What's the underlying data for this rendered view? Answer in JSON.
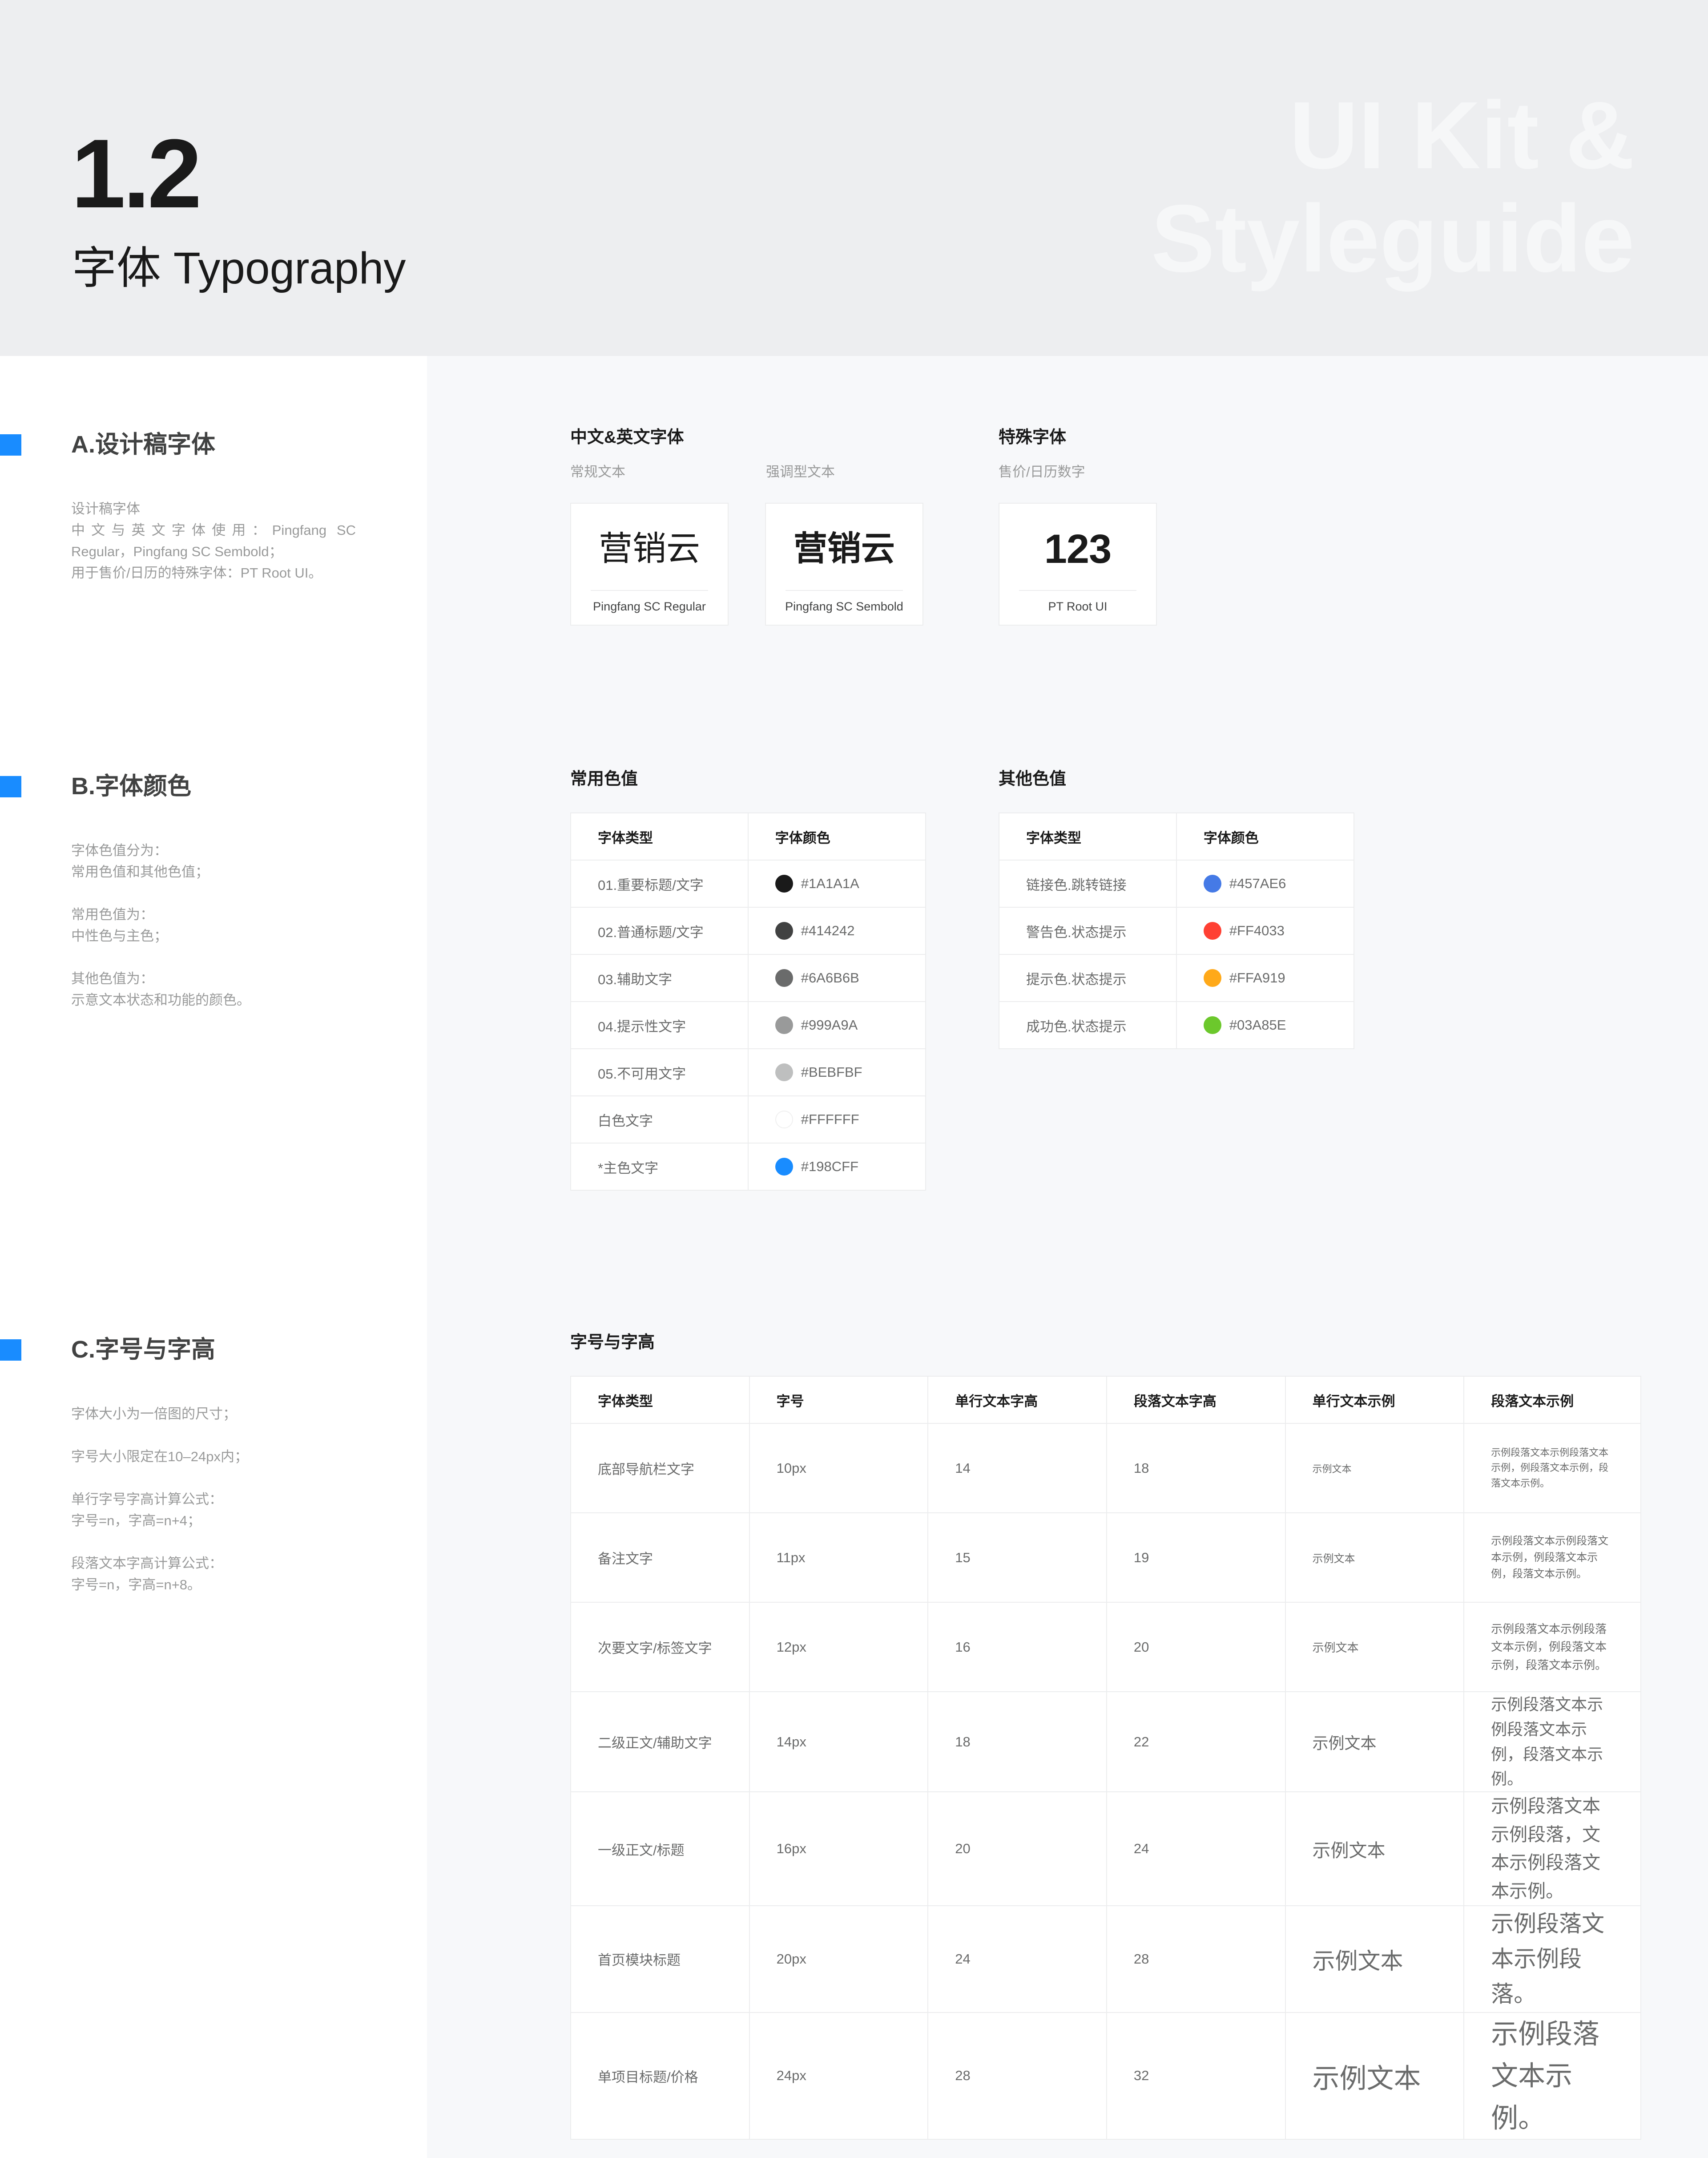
{
  "header": {
    "number": "1.2",
    "title": "字体 Typography",
    "watermark": "UI Kit &\nStyleguide"
  },
  "sections": {
    "a": {
      "title": "A.设计稿字体",
      "desc": [
        "设计稿字体",
        "中文与英文字体使用：Pingfang SC",
        "Regular，Pingfang SC Sembold；",
        "用于售价/日历的特殊字体：PT Root UI。"
      ]
    },
    "b": {
      "title": "B.字体颜色",
      "desc": [
        "字体色值分为：",
        "常用色值和其他色值；",
        "",
        "常用色值为：",
        "中性色与主色；",
        "",
        "其他色值为：",
        "示意文本状态和功能的颜色。"
      ]
    },
    "c": {
      "title": "C.字号与字高",
      "desc": [
        "字体大小为一倍图的尺寸；",
        "",
        "字号大小限定在10–24px内；",
        "",
        "单行字号字高计算公式：",
        "字号=n，字高=n+4；",
        "",
        "段落文本字高计算公式：",
        "字号=n，字高=n+8。"
      ]
    }
  },
  "fonts": {
    "group1_title": "中文&英文字体",
    "group2_title": "特殊字体",
    "cards": [
      {
        "caption": "常规文本",
        "sample": "营销云",
        "font_name": "Pingfang SC Regular"
      },
      {
        "caption": "强调型文本",
        "sample": "营销云",
        "font_name": "Pingfang SC Sembold"
      },
      {
        "caption": "售价/日历数字",
        "sample": "123",
        "font_name": "PT Root UI"
      }
    ]
  },
  "colors": {
    "common_title": "常用色值",
    "other_title": "其他色值",
    "headers": [
      "字体类型",
      "字体颜色"
    ],
    "common": [
      {
        "type": "01.重要标题/文字",
        "hex": "#1A1A1A",
        "color": "#1A1A1A"
      },
      {
        "type": "02.普通标题/文字",
        "hex": "#414242",
        "color": "#414242"
      },
      {
        "type": "03.辅助文字",
        "hex": "#6A6B6B",
        "color": "#6A6B6B"
      },
      {
        "type": "04.提示性文字",
        "hex": "#999A9A",
        "color": "#999A9A"
      },
      {
        "type": "05.不可用文字",
        "hex": "#BEBFBF",
        "color": "#BEBFBF"
      },
      {
        "type": "白色文字",
        "hex": "#FFFFFF",
        "color": "#FFFFFF"
      },
      {
        "type": "*主色文字",
        "hex": "#198CFF",
        "color": "#198CFF"
      }
    ],
    "other": [
      {
        "type": "链接色.跳转链接",
        "hex": "#457AE6",
        "color": "#457AE6"
      },
      {
        "type": "警告色.状态提示",
        "hex": "#FF4033",
        "color": "#FF4033"
      },
      {
        "type": "提示色.状态提示",
        "hex": "#FFA919",
        "color": "#FFA919"
      },
      {
        "type": "成功色.状态提示",
        "hex": "#03A85E",
        "color": "#6CC82C"
      }
    ]
  },
  "sizes": {
    "title": "字号与字高",
    "headers": [
      "字体类型",
      "字号",
      "单行文本字高",
      "段落文本字高",
      "单行文本示例",
      "段落文本示例"
    ],
    "rows": [
      {
        "type": "底部导航栏文字",
        "size": "10px",
        "line": "14",
        "para": "18",
        "example": "示例文本",
        "para_example": "示例段落文本示例段落文本示例，例段落文本示例，段落文本示例。"
      },
      {
        "type": "备注文字",
        "size": "11px",
        "line": "15",
        "para": "19",
        "example": "示例文本",
        "para_example": "示例段落文本示例段落文本示例，例段落文本示例，段落文本示例。"
      },
      {
        "type": "次要文字/标签文字",
        "size": "12px",
        "line": "16",
        "para": "20",
        "example": "示例文本",
        "para_example": "示例段落文本示例段落文本示例，例段落文本示例，段落文本示例。"
      },
      {
        "type": "二级正文/辅助文字",
        "size": "14px",
        "line": "18",
        "para": "22",
        "example": "示例文本",
        "para_example": "示例段落文本示例段落文本示例，段落文本示例。"
      },
      {
        "type": "一级正文/标题",
        "size": "16px",
        "line": "20",
        "para": "24",
        "example": "示例文本",
        "para_example": "示例段落文本示例段落，文本示例段落文本示例。"
      },
      {
        "type": "首页模块标题",
        "size": "20px",
        "line": "24",
        "para": "28",
        "example": "示例文本",
        "para_example": "示例段落文本示例段落。"
      },
      {
        "type": "单项目标题/价格",
        "size": "24px",
        "line": "28",
        "para": "32",
        "example": "示例文本",
        "para_example": "示例段落文本示例。"
      }
    ]
  }
}
